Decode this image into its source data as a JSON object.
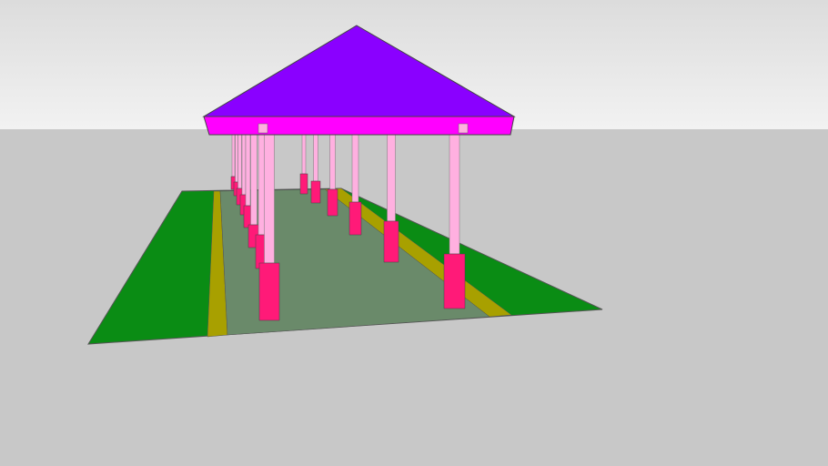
{
  "scene": {
    "description_hidden": "",
    "colors": {
      "sky_top": "#dcdcdc",
      "sky_bottom": "#f2f2f2",
      "ground": "#c8c8c8",
      "lawn": "#0a8c14",
      "path": "#6a8a6a",
      "strip": "#a8a000",
      "roof": "#8a00ff",
      "fascia": "#ff00ff",
      "pillar": "#ffb0e0",
      "base": "#ff1a78",
      "edge": "#555555"
    }
  }
}
